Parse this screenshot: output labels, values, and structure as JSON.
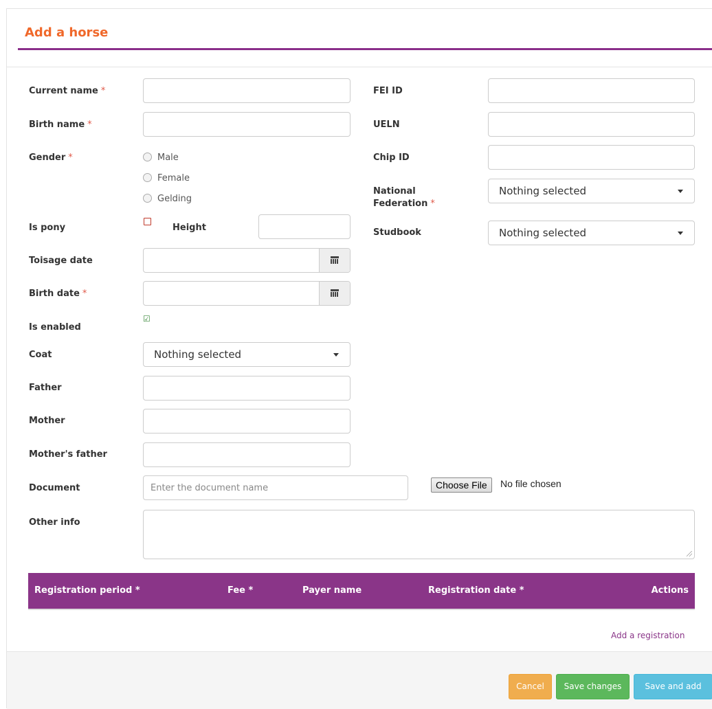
{
  "header": {
    "title": "Add a horse"
  },
  "form": {
    "left": {
      "current_name": {
        "label": "Current name",
        "required": "*",
        "value": ""
      },
      "birth_name": {
        "label": "Birth name",
        "required": "*",
        "value": ""
      },
      "gender": {
        "label": "Gender",
        "required": "*",
        "options": [
          "Male",
          "Female",
          "Gelding"
        ]
      },
      "is_pony": {
        "label": "Is pony",
        "checked": false
      },
      "height": {
        "label": "Height",
        "value": ""
      },
      "toisage_date": {
        "label": "Toisage date",
        "value": ""
      },
      "birth_date": {
        "label": "Birth date",
        "required": "*",
        "value": ""
      },
      "is_enabled": {
        "label": "Is enabled",
        "checked": true,
        "icon": "checked-box-icon"
      },
      "coat": {
        "label": "Coat",
        "selected": "Nothing selected"
      },
      "father": {
        "label": "Father",
        "value": ""
      },
      "mother": {
        "label": "Mother",
        "value": ""
      },
      "mothers_father": {
        "label": "Mother's father",
        "value": ""
      },
      "document": {
        "label": "Document",
        "placeholder": "Enter the document name",
        "file_button": "Choose File",
        "file_status": "No file chosen"
      },
      "other_info": {
        "label": "Other info",
        "value": ""
      }
    },
    "right": {
      "fei_id": {
        "label": "FEI ID",
        "value": ""
      },
      "ueln": {
        "label": "UELN",
        "value": ""
      },
      "chip_id": {
        "label": "Chip ID",
        "value": ""
      },
      "national_federation": {
        "label_line1": "National",
        "label_line2": "Federation",
        "required": "*",
        "selected": "Nothing selected"
      },
      "studbook": {
        "label": "Studbook",
        "selected": "Nothing selected"
      }
    }
  },
  "registrations": {
    "columns": [
      "Registration period *",
      "Fee *",
      "Payer name",
      "Registration date *",
      "Actions"
    ],
    "rows": [],
    "add_link": "Add a registration"
  },
  "footer": {
    "cancel": "Cancel",
    "save": "Save changes",
    "save_add": "Save and add"
  },
  "colors": {
    "title": "#f0682a",
    "accent": "#8a3588",
    "cancel": "#f0ad4e",
    "save": "#5cb85c",
    "save_add": "#5bc0de"
  }
}
